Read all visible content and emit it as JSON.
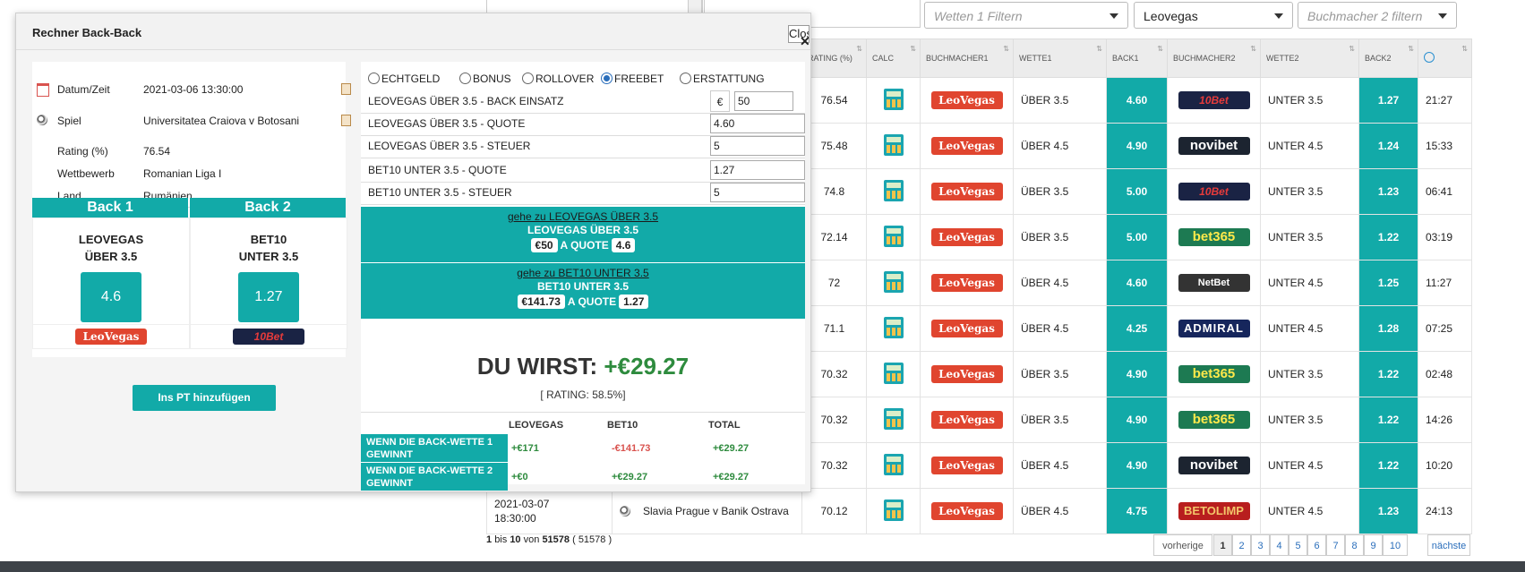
{
  "filters": {
    "wette1_placeholder": "Wetten 1 Filtern",
    "buchmacher1_value": "Leovegas",
    "buchmacher2_placeholder": "Buchmacher 2 filtern"
  },
  "table": {
    "headers": {
      "rating": "RATING (%)",
      "calc": "CALC",
      "buchmacher1": "BUCHMACHER1",
      "wette1": "WETTE1",
      "back1": "BACK1",
      "buchmacher2": "BUCHMACHER2",
      "wette2": "WETTE2",
      "back2": "BACK2"
    },
    "rows": [
      {
        "rating": "76.54",
        "bm1": "LeoVegas",
        "w1": "ÜBER 3.5",
        "b1": "4.60",
        "bm2": "10Bet",
        "w2": "UNTER 3.5",
        "b2": "1.27",
        "t": "21:27"
      },
      {
        "rating": "75.48",
        "bm1": "LeoVegas",
        "w1": "ÜBER 4.5",
        "b1": "4.90",
        "bm2": "novibet",
        "w2": "UNTER 4.5",
        "b2": "1.24",
        "t": "15:33"
      },
      {
        "rating": "74.8",
        "bm1": "LeoVegas",
        "w1": "ÜBER 3.5",
        "b1": "5.00",
        "bm2": "10Bet",
        "w2": "UNTER 3.5",
        "b2": "1.23",
        "t": "06:41"
      },
      {
        "rating": "72.14",
        "bm1": "LeoVegas",
        "w1": "ÜBER 3.5",
        "b1": "5.00",
        "bm2": "bet365",
        "w2": "UNTER 3.5",
        "b2": "1.22",
        "t": "03:19"
      },
      {
        "rating": "72",
        "bm1": "LeoVegas",
        "w1": "ÜBER 4.5",
        "b1": "4.60",
        "bm2": "NetBet",
        "w2": "UNTER 4.5",
        "b2": "1.25",
        "t": "11:27"
      },
      {
        "rating": "71.1",
        "bm1": "LeoVegas",
        "w1": "ÜBER 4.5",
        "b1": "4.25",
        "bm2": "ADMIRAL",
        "w2": "UNTER 4.5",
        "b2": "1.28",
        "t": "07:25"
      },
      {
        "rating": "70.32",
        "bm1": "LeoVegas",
        "w1": "ÜBER 3.5",
        "b1": "4.90",
        "bm2": "bet365",
        "w2": "UNTER 3.5",
        "b2": "1.22",
        "t": "02:48"
      },
      {
        "rating": "70.32",
        "bm1": "LeoVegas",
        "w1": "ÜBER 3.5",
        "b1": "4.90",
        "bm2": "bet365",
        "w2": "UNTER 3.5",
        "b2": "1.22",
        "t": "14:26"
      },
      {
        "rating": "70.32",
        "bm1": "LeoVegas",
        "w1": "ÜBER 4.5",
        "b1": "4.90",
        "bm2": "novibet",
        "w2": "UNTER 4.5",
        "b2": "1.22",
        "t": "10:20"
      },
      {
        "date": "2021-03-07",
        "time": "18:30:00",
        "match": "Slavia Prague v Banik Ostrava",
        "rating": "70.12",
        "bm1": "LeoVegas",
        "w1": "ÜBER 4.5",
        "b1": "4.75",
        "bm2": "BETOLIMP",
        "w2": "UNTER 4.5",
        "b2": "1.23",
        "t": "24:13"
      }
    ]
  },
  "pagination": {
    "info_from": "1",
    "info_mid": "bis",
    "info_to": "10",
    "info_von": "von",
    "info_total": "51578",
    "info_paren": "( 51578 )",
    "prev": "vorherige",
    "pages": [
      "1",
      "2",
      "3",
      "4",
      "5",
      "6",
      "7",
      "8",
      "9",
      "10"
    ],
    "next": "nächste"
  },
  "modal": {
    "title": "Rechner Back-Back",
    "close": "Close",
    "info": {
      "datum_label": "Datum/Zeit",
      "datum_value": "2021-03-06 13:30:00",
      "spiel_label": "Spiel",
      "spiel_value": "Universitatea Craiova v Botosani",
      "rating_label": "Rating (%)",
      "rating_value": "76.54",
      "wettbewerb_label": "Wettbewerb",
      "wettbewerb_value": "Romanian Liga I",
      "land_label": "Land",
      "land_value": "Rumänien"
    },
    "back1": {
      "header": "Back 1",
      "name": "LEOVEGAS\nÜBER 3.5",
      "quote": "4.6",
      "logo": "LeoVegas"
    },
    "back2": {
      "header": "Back 2",
      "name": "BET10\nUNTER 3.5",
      "quote": "1.27",
      "logo": "10Bet"
    },
    "add_button": "Ins PT hinzufügen",
    "modes": [
      "ECHTGELD",
      "BONUS",
      "ROLLOVER",
      "FREEBET",
      "ERSTATTUNG"
    ],
    "selected_mode": "FREEBET",
    "fields": {
      "einsatz_label": "LEOVEGAS ÜBER 3.5 - BACK EINSATZ",
      "currency": "€",
      "einsatz_value": "50",
      "quote1_label": "LEOVEGAS ÜBER 3.5 - QUOTE",
      "quote1_value": "4.60",
      "steuer1_label": "LEOVEGAS ÜBER 3.5 - STEUER",
      "steuer1_value": "5",
      "quote2_label": "BET10 UNTER 3.5  - QUOTE",
      "quote2_value": "1.27",
      "steuer2_label": "BET10 UNTER 3.5 - STEUER",
      "steuer2_value": "5"
    },
    "go1": {
      "link": "gehe zu LEOVEGAS ÜBER 3.5",
      "title": "LEOVEGAS ÜBER 3.5",
      "stake": "€50",
      "a_quote": "A QUOTE",
      "quote": "4.6"
    },
    "go2": {
      "link": "gehe zu BET10 UNTER 3.5",
      "title": "BET10 UNTER 3.5",
      "stake": "€141.73",
      "a_quote": "A QUOTE",
      "quote": "1.27"
    },
    "result_label": "DU WIRST:",
    "result_value": "+€29.27",
    "rating_text": "[ RATING: 58.5%]",
    "res_headers": {
      "leovegas": "LEOVEGAS",
      "bet10": "BET10",
      "total": "TOTAL"
    },
    "res_row1": {
      "label": "WENN DIE BACK-WETTE 1 GEWINNT",
      "leovegas": "+€171",
      "bet10": "-€141.73",
      "total": "+€29.27"
    },
    "res_row2": {
      "label": "WENN DIE BACK-WETTE 2 GEWINNT",
      "leovegas": "+€0",
      "bet10": "+€29.27",
      "total": "+€29.27"
    }
  }
}
